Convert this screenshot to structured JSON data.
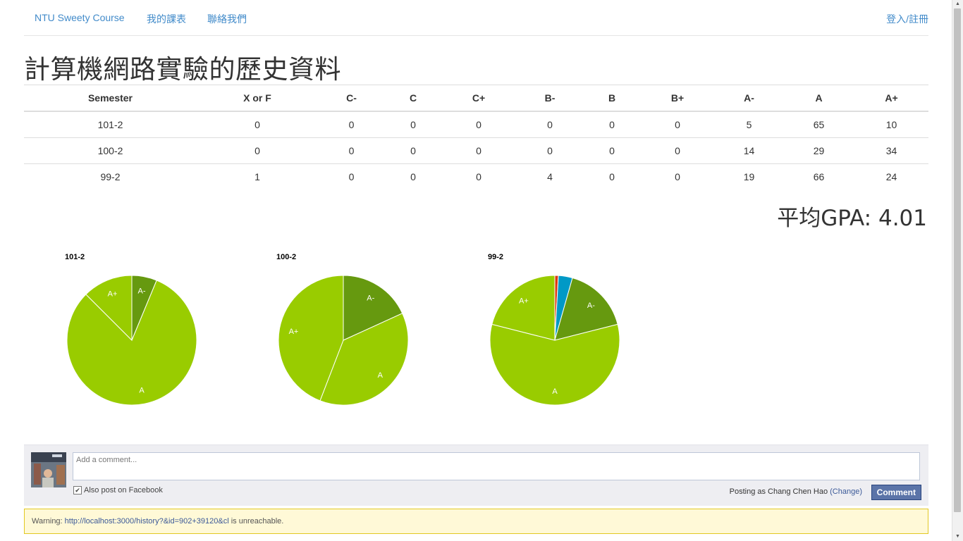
{
  "nav": {
    "brand": "NTU Sweety Course",
    "my_schedule": "我的課表",
    "contact": "聯絡我們",
    "login": "登入/註冊"
  },
  "page_title": "計算機網路實驗的歷史資料",
  "table": {
    "headers": [
      "Semester",
      "X or F",
      "C-",
      "C",
      "C+",
      "B-",
      "B",
      "B+",
      "A-",
      "A",
      "A+"
    ],
    "rows": [
      [
        "101-2",
        "0",
        "0",
        "0",
        "0",
        "0",
        "0",
        "0",
        "5",
        "65",
        "10"
      ],
      [
        "100-2",
        "0",
        "0",
        "0",
        "0",
        "0",
        "0",
        "0",
        "14",
        "29",
        "34"
      ],
      [
        "99-2",
        "1",
        "0",
        "0",
        "0",
        "4",
        "0",
        "0",
        "19",
        "66",
        "24"
      ]
    ]
  },
  "gpa_text": "平均GPA: 4.01",
  "chart_data": [
    {
      "type": "pie",
      "title": "101-2",
      "categories": [
        "X or F",
        "B-",
        "A-",
        "A",
        "A+"
      ],
      "values": [
        0,
        0,
        5,
        65,
        10
      ],
      "colors": [
        "#dc3912",
        "#0099c6",
        "#66990f",
        "#99cc00",
        "#99cc00"
      ],
      "slice_labels": [
        "",
        "",
        "A-",
        "A",
        "A+"
      ]
    },
    {
      "type": "pie",
      "title": "100-2",
      "categories": [
        "X or F",
        "B-",
        "A-",
        "A",
        "A+"
      ],
      "values": [
        0,
        0,
        14,
        29,
        34
      ],
      "colors": [
        "#dc3912",
        "#0099c6",
        "#66990f",
        "#99cc00",
        "#99cc00"
      ],
      "slice_labels": [
        "",
        "",
        "A-",
        "A",
        "A+"
      ]
    },
    {
      "type": "pie",
      "title": "99-2",
      "categories": [
        "X or F",
        "B-",
        "A-",
        "A",
        "A+"
      ],
      "values": [
        1,
        4,
        19,
        66,
        24
      ],
      "colors": [
        "#dc3912",
        "#0099c6",
        "#66990f",
        "#99cc00",
        "#99cc00"
      ],
      "slice_labels": [
        "",
        "",
        "A-",
        "A",
        "A+"
      ]
    }
  ],
  "comment": {
    "placeholder": "Add a comment...",
    "also_post_label": "Also post on Facebook",
    "also_post_checked": true,
    "posting_as_prefix": "Posting as Chang Chen Hao",
    "change_label": "(Change)",
    "button_label": "Comment"
  },
  "warning": {
    "prefix": "Warning:",
    "url": "http://localhost:3000/history?&id=902+39120&cl",
    "suffix": "is unreachable."
  }
}
